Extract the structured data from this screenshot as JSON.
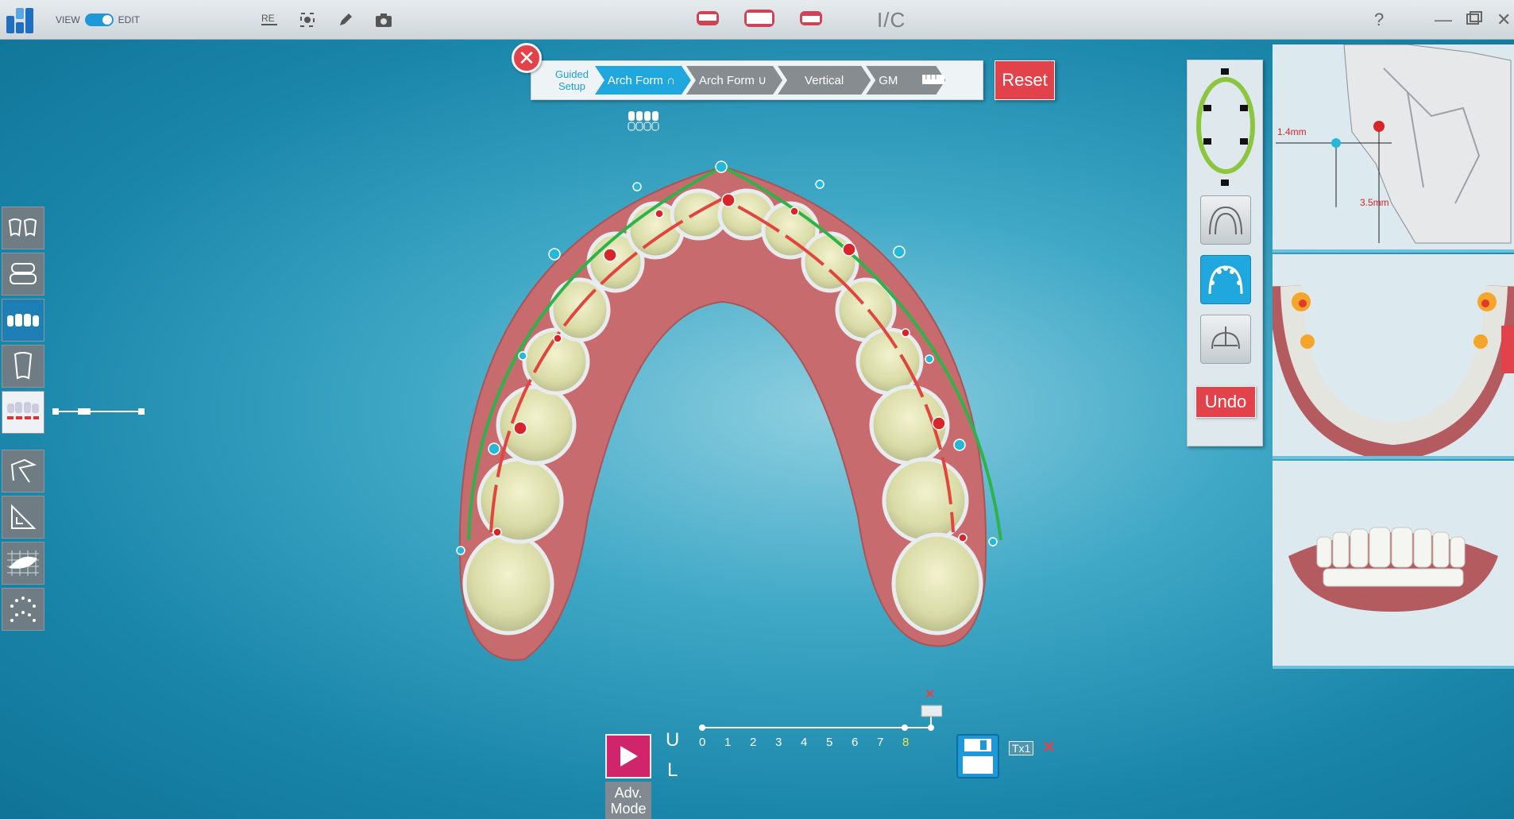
{
  "topbar": {
    "view_label": "VIEW",
    "edit_label": "EDIT",
    "center_title": "I/C",
    "help": "?",
    "icons": [
      "re-icon",
      "focus-icon",
      "pen-icon",
      "camera-icon"
    ],
    "view_icons": [
      "upper-teeth-icon",
      "front-teeth-icon",
      "lower-teeth-icon"
    ]
  },
  "guided": {
    "setup_line1": "Guided",
    "setup_line2": "Setup",
    "steps": [
      {
        "label": "Arch Form ∩",
        "active": true
      },
      {
        "label": "Arch Form ∪",
        "active": false
      },
      {
        "label": "Vertical",
        "active": false
      },
      {
        "label": "GM",
        "active": false
      }
    ],
    "close": "✕",
    "reset": "Reset"
  },
  "right_panel": {
    "undo": "Undo"
  },
  "measure_view": {
    "label1": "1.4mm",
    "label2": "3.5mm"
  },
  "timeline": {
    "upper": "U",
    "lower": "L",
    "stages": [
      "0",
      "1",
      "2",
      "3",
      "4",
      "5",
      "6",
      "7",
      "8"
    ],
    "current": "8",
    "adv_line1": "Adv.",
    "adv_line2": "Mode",
    "tx": "Tx1",
    "x": "✕"
  },
  "colors": {
    "accent": "#1fa7de",
    "danger": "#e2434a",
    "play": "#d0246b",
    "stage_current": "#f2e34a"
  }
}
